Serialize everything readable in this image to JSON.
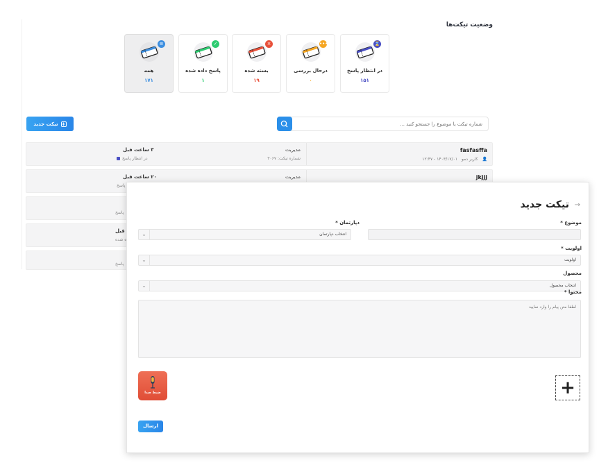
{
  "status": {
    "heading": "وضعیت تیکت‌ها",
    "cards": [
      {
        "id": "waiting",
        "label": "در انتظار پاسخ",
        "count": "۱۵۱",
        "color": "#4a4fc4",
        "badge_icon": "hourglass-icon"
      },
      {
        "id": "reviewing",
        "label": "درحال بررسی",
        "count": "۰",
        "color": "#f5a623",
        "badge_icon": "ellipsis-icon"
      },
      {
        "id": "closed",
        "label": "بسته شده",
        "count": "۱۹",
        "color": "#e8503a",
        "badge_icon": "close-icon"
      },
      {
        "id": "answered",
        "label": "پاسخ داده شده",
        "count": "۱",
        "color": "#2ecc71",
        "badge_icon": "check-icon"
      },
      {
        "id": "all",
        "label": "همه",
        "count": "۱۷۱",
        "color": "#3d8fe0",
        "badge_icon": "list-icon"
      }
    ]
  },
  "toolbar": {
    "new_ticket_label": "تیکت جدید",
    "search_placeholder": "شماره تیکت یا موضوع را جستجو کنید ..."
  },
  "tickets": [
    {
      "title": "fasfasffa",
      "user": "کاربر دمو",
      "date": "۱۴۰۳/۱۷/۰۱ - ۱۲:۴۷",
      "department": "مدیریت",
      "number": "شماره تیکت: ۳۰۶۷",
      "time": "۳ ساعت قبل",
      "state": "در انتظار پاسخ"
    },
    {
      "title": "jkjjj",
      "department": "مدیریت",
      "time": "۲۰ ساعت قبل",
      "state": "پاسخ"
    }
  ],
  "stubs": [
    {
      "line1": "",
      "line2": "پاسخ"
    },
    {
      "line1": "قبل",
      "line2": "ده شده"
    },
    {
      "line1": "",
      "line2": "پاسخ"
    }
  ],
  "modal": {
    "title": "تیکت جدید",
    "subject_label": "موضوع *",
    "department_label": "دپارتمان *",
    "department_value": "انتخاب دپارتمان",
    "priority_label": "اولویت *",
    "priority_value": "اولویت",
    "product_label": "محصول",
    "product_value": "انتخاب محصول",
    "content_label": "محتوا *",
    "content_placeholder": "لطفا متن پیام را وارد نمایید",
    "voice_label": "ضبط صدا",
    "send_label": "ارسال"
  }
}
